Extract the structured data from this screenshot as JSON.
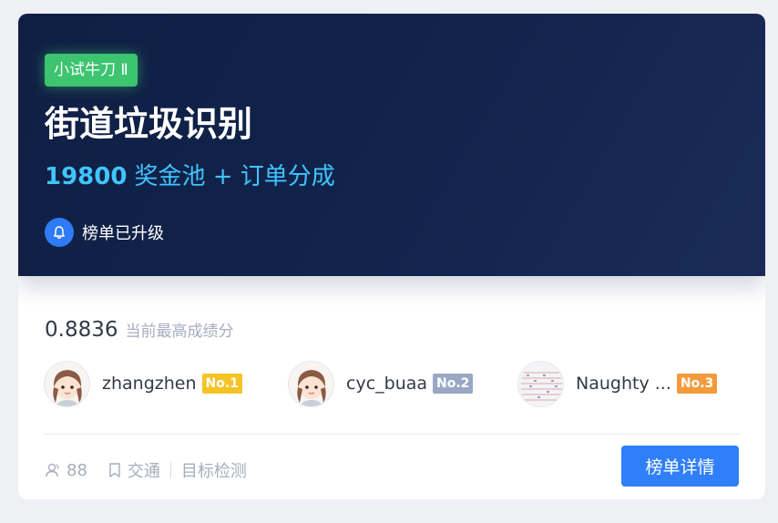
{
  "banner": {
    "tag": "小试牛刀 Ⅱ",
    "title": "街道垃圾识别",
    "prize_amount": "19800",
    "prize_text": "奖金池 + 订单分成",
    "upgrade_label": "榜单已升级"
  },
  "score": {
    "value": "0.8836",
    "label": "当前最高成绩分"
  },
  "leaderboard": [
    {
      "name": "zhangzhen",
      "badge": "No.1",
      "avatar": "cartoon-girl-avatar"
    },
    {
      "name": "cyc_buaa",
      "badge": "No.2",
      "avatar": "cartoon-girl-avatar"
    },
    {
      "name": "Naughty ...",
      "badge": "No.3",
      "avatar": "pattern-avatar"
    }
  ],
  "meta": {
    "participants": "88",
    "category": "交通",
    "task": "目标检测"
  },
  "detail_button": "榜单详情",
  "colors": {
    "banner_bg": "#12244c",
    "tag_green": "#3cc46e",
    "prize_blue": "#41c4ff",
    "accent_blue": "#2f7ff8",
    "badge_gold": "#f5c325",
    "badge_silver": "#9aa8c4",
    "badge_bronze": "#f39b3b"
  }
}
